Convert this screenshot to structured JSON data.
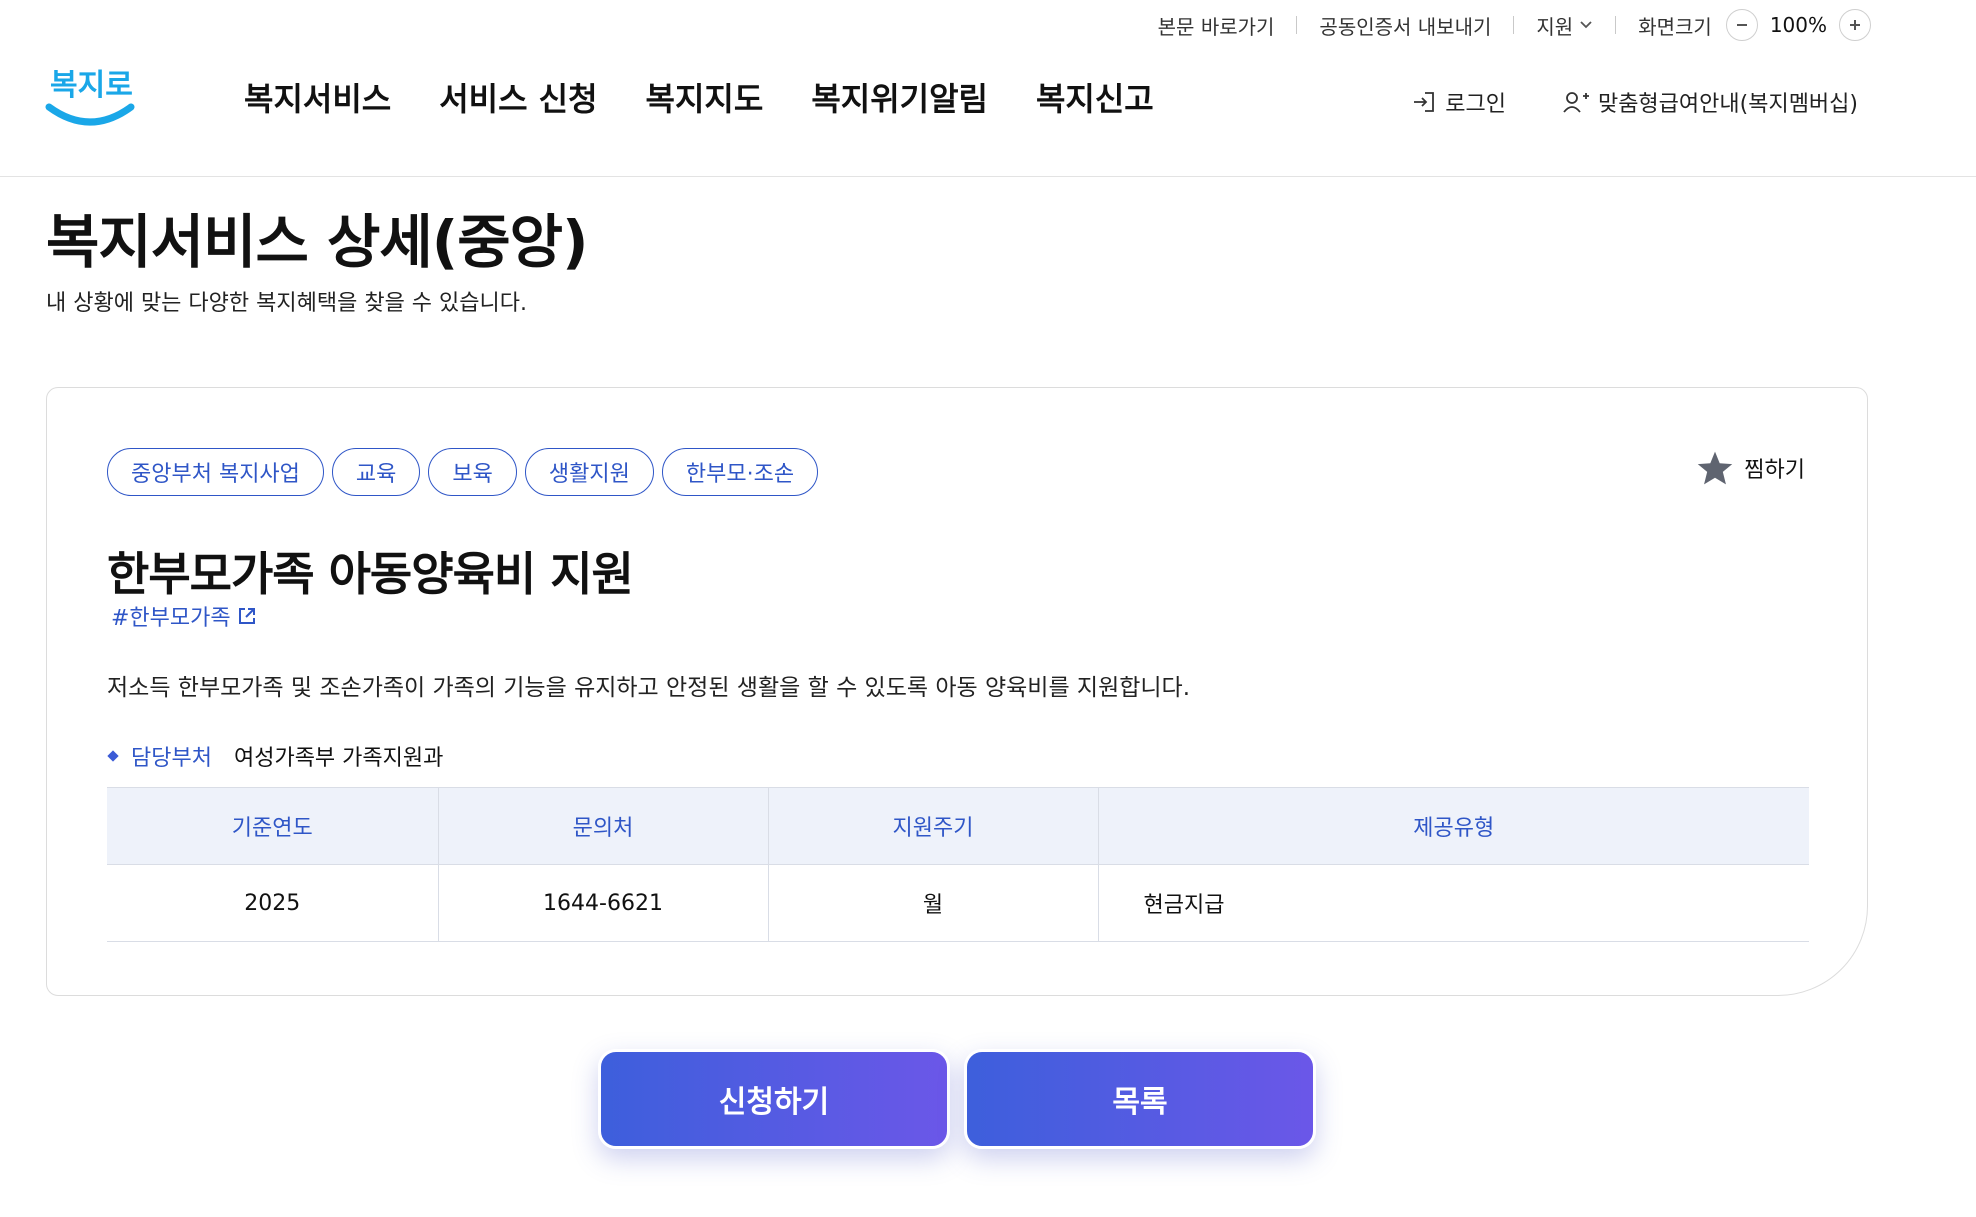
{
  "util": {
    "skip_link": "본문 바로가기",
    "cert_export": "공동인증서 내보내기",
    "support": "지원",
    "screen_size": "화면크기",
    "zoom": "100%"
  },
  "header": {
    "logo_text": "복지로",
    "nav": [
      "복지서비스",
      "서비스 신청",
      "복지지도",
      "복지위기알림",
      "복지신고"
    ],
    "login": "로그인",
    "membership": "맞춤형급여안내(복지멤버십)"
  },
  "page": {
    "title": "복지서비스 상세(중앙)",
    "description": "내 상황에 맞는 다양한 복지혜택을 찾을 수 있습니다."
  },
  "detail": {
    "tags": [
      "중앙부처 복지사업",
      "교육",
      "보육",
      "생활지원",
      "한부모·조손"
    ],
    "favorite": "찜하기",
    "title": "한부모가족 아동양육비 지원",
    "hashtag": "#한부모가족",
    "description": "저소득 한부모가족 및 조손가족이 가족의 기능을 유지하고 안정된 생활을 할 수 있도록 아동 양육비를 지원합니다.",
    "dept_label": "담당부처",
    "dept_value": "여성가족부 가족지원과",
    "table": {
      "headers": [
        "기준연도",
        "문의처",
        "지원주기",
        "제공유형"
      ],
      "row": [
        "2025",
        "1644-6621",
        "월",
        "현금지급"
      ]
    }
  },
  "actions": {
    "apply": "신청하기",
    "list": "목록"
  },
  "colors": {
    "accent": "#2f56c7",
    "button_gradient_start": "#3d5fdc",
    "button_gradient_end": "#6b57e8",
    "table_header_bg": "#eef2fa",
    "logo_smile": "#1aa7e8"
  }
}
